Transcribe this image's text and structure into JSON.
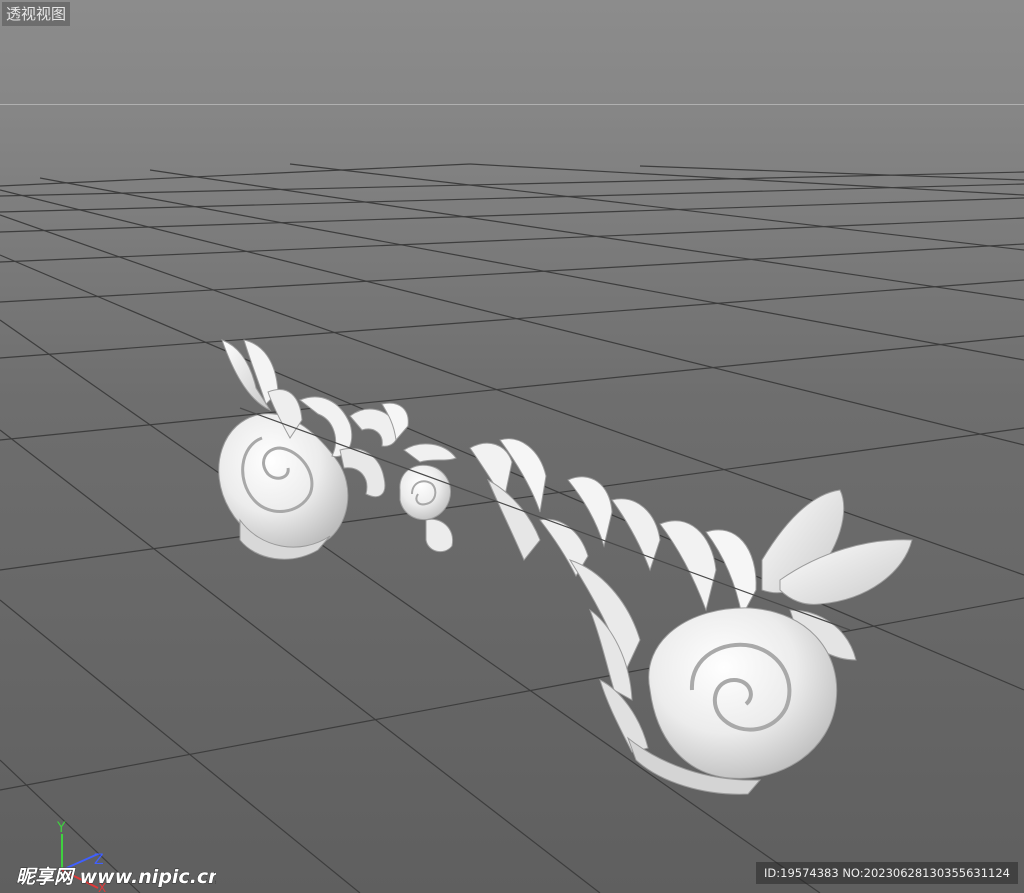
{
  "viewport": {
    "title": "透视视图",
    "background_color": "#7a7a7a",
    "grid_color": "#3a3a3a",
    "object": "ornamental-scroll-carving",
    "object_color": "#f0f0f0"
  },
  "axis_gizmo": {
    "y_label": "Y",
    "z_label": "Z",
    "x_label": "X",
    "y_color": "#3fd13f",
    "z_color": "#3f5fff",
    "x_color": "#e23a3a"
  },
  "watermark": {
    "logo_text": "昵享网 www.nipic.cn",
    "id_text": "ID:19574383 NO:20230628130355631124"
  }
}
